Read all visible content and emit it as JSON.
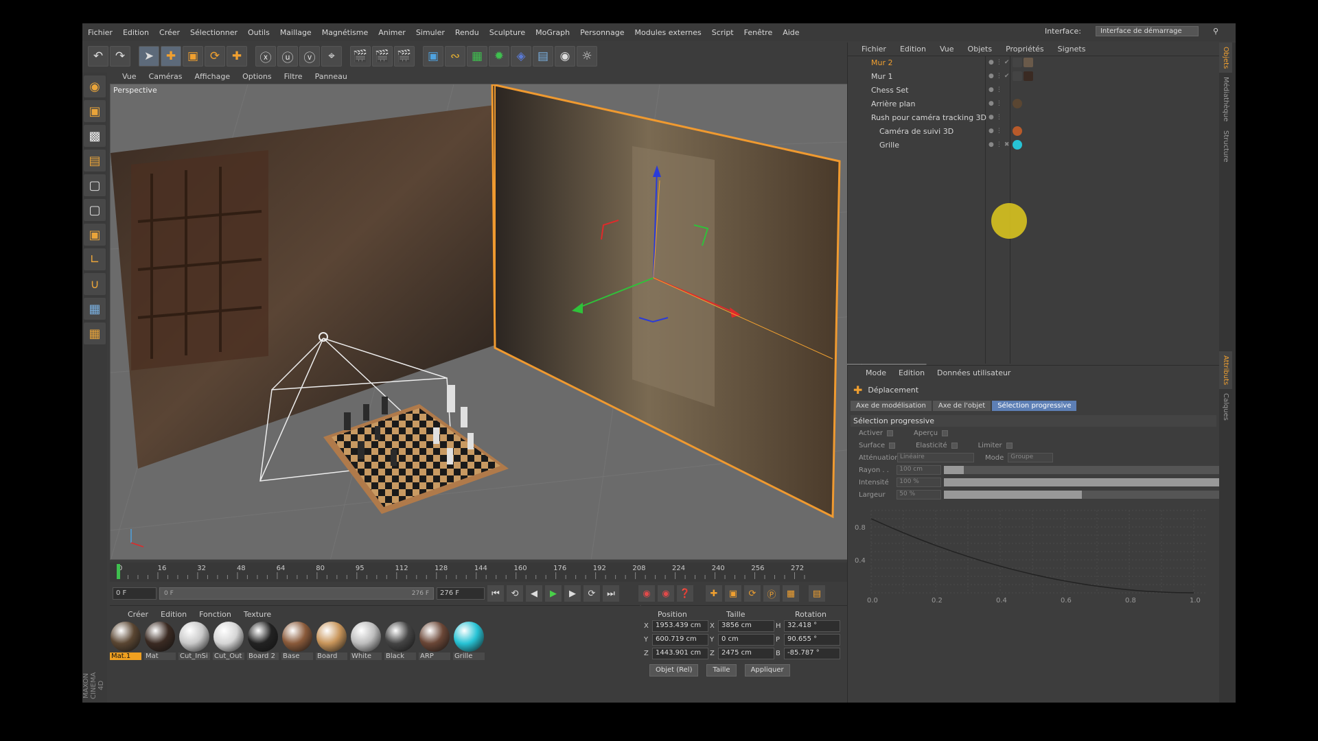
{
  "menubar": {
    "items": [
      "Fichier",
      "Edition",
      "Créer",
      "Sélectionner",
      "Outils",
      "Maillage",
      "Magnétisme",
      "Animer",
      "Simuler",
      "Rendu",
      "Sculpture",
      "MoGraph",
      "Personnage",
      "Modules externes",
      "Script",
      "Fenêtre",
      "Aide"
    ],
    "interface_label": "Interface:",
    "interface_value": "Interface de démarrage"
  },
  "viewport": {
    "menu": [
      "Vue",
      "Caméras",
      "Affichage",
      "Options",
      "Filtre",
      "Panneau"
    ],
    "label": "Perspective"
  },
  "timeline": {
    "ticks": [
      "0",
      "16",
      "32",
      "48",
      "64",
      "80",
      "95",
      "112",
      "128",
      "144",
      "160",
      "176",
      "192",
      "208",
      "224",
      "240",
      "256",
      "272"
    ],
    "current_frame": "0 F"
  },
  "transport": {
    "start": "0 F",
    "slider_start": "0 F",
    "slider_end": "276 F",
    "end": "276 F"
  },
  "materials": {
    "menu": [
      "Créer",
      "Edition",
      "Fonction",
      "Texture"
    ],
    "items": [
      {
        "name": "Mat.1",
        "color": "#5a4632",
        "selected": true
      },
      {
        "name": "Mat",
        "color": "#3a2a22",
        "selected": false
      },
      {
        "name": "Cut_InSi",
        "color": "#c9c9c9",
        "selected": false
      },
      {
        "name": "Cut_Out",
        "color": "#d5d5d5",
        "selected": false
      },
      {
        "name": "Board 2",
        "color": "#222222",
        "selected": false
      },
      {
        "name": "Base",
        "color": "#8a5a3a",
        "selected": false
      },
      {
        "name": "Board",
        "color": "#c8955a",
        "selected": false
      },
      {
        "name": "White",
        "color": "#bdbdbd",
        "selected": false
      },
      {
        "name": "Black",
        "color": "#444444",
        "selected": false
      },
      {
        "name": "ARP",
        "color": "#6a4636",
        "selected": false
      },
      {
        "name": "Grille",
        "color": "#27c3d5",
        "selected": false
      }
    ]
  },
  "coords": {
    "headers": [
      "Position",
      "Taille",
      "Rotation"
    ],
    "rows": [
      {
        "axis": "X",
        "pos": "1953.439 cm",
        "size_axis": "X",
        "size": "3856 cm",
        "rot_axis": "H",
        "rot": "32.418 °"
      },
      {
        "axis": "Y",
        "pos": "600.719 cm",
        "size_axis": "Y",
        "size": "0 cm",
        "rot_axis": "P",
        "rot": "90.655 °"
      },
      {
        "axis": "Z",
        "pos": "1443.901 cm",
        "size_axis": "Z",
        "size": "2475 cm",
        "rot_axis": "B",
        "rot": "-85.787 °"
      }
    ],
    "mode": "Objet (Rel)",
    "size_mode": "Taille",
    "apply": "Appliquer"
  },
  "branding": "MAXON CINEMA 4D",
  "objects": {
    "menu": [
      "Fichier",
      "Edition",
      "Vue",
      "Objets",
      "Propriétés",
      "Signets"
    ],
    "rows": [
      {
        "name": "Mur 2",
        "highlight": true
      },
      {
        "name": "Mur 1",
        "highlight": false
      },
      {
        "name": "Chess Set",
        "highlight": false
      },
      {
        "name": "Arrière plan",
        "highlight": false
      },
      {
        "name": "Rush pour caméra tracking 3D",
        "highlight": false
      },
      {
        "name": "Caméra de suivi 3D",
        "highlight": false
      },
      {
        "name": "Grille",
        "highlight": false
      }
    ]
  },
  "attributes": {
    "menu": [
      "Mode",
      "Edition",
      "Données utilisateur"
    ],
    "tool": "Déplacement",
    "tabs": [
      "Axe de modélisation",
      "Axe de l'objet",
      "Sélection progressive"
    ],
    "section": "Sélection progressive",
    "activer": "Activer",
    "apercu": "Aperçu",
    "surface": "Surface",
    "elasticite": "Elasticité",
    "limiter": "Limiter",
    "attenuation_label": "Atténuation",
    "attenuation_value": "Linéaire",
    "mode_label": "Mode",
    "mode_value": "Groupe",
    "rayon_label": "Rayon . .",
    "rayon_value": "100 cm",
    "rayon_fill": 0.07,
    "intensite_label": "Intensité",
    "intensite_value": "100 %",
    "intensite_fill": 1.0,
    "largeur_label": "Largeur",
    "largeur_value": "50 %",
    "largeur_fill": 0.5,
    "graph_x": [
      "0.0",
      "0.2",
      "0.4",
      "0.6",
      "0.8",
      "1.0"
    ],
    "graph_y": [
      "0.8",
      "0.4"
    ]
  },
  "sidetabs": [
    "Objets",
    "Médiathèque",
    "Structure",
    "Attributs",
    "Calques"
  ]
}
